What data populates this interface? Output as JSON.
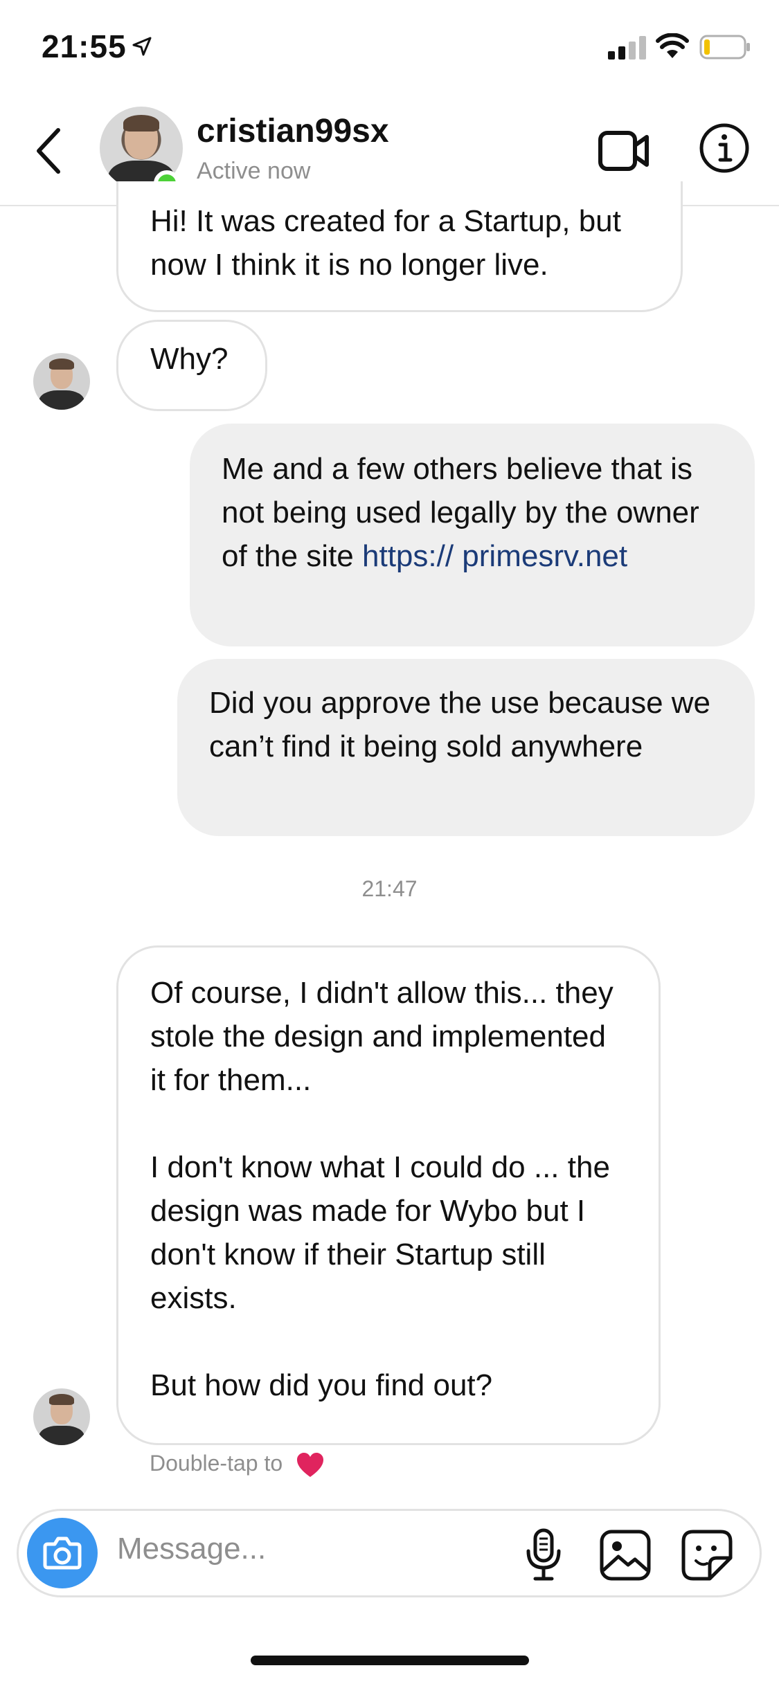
{
  "status_bar": {
    "time": "21:55"
  },
  "header": {
    "username": "cristian99sx",
    "status": "Active now"
  },
  "messages": [
    {
      "sender": "them",
      "text": "Hi! It was created for a Startup, but now I think it is no longer live."
    },
    {
      "sender": "them",
      "text": "Why?"
    },
    {
      "sender": "me",
      "text_before_link": "Me and a few others believe that is not being used legally by the owner of the site ",
      "link": "https:// primesrv.net"
    },
    {
      "sender": "me",
      "text": "Did you approve the use because we can’t find it being sold anywhere"
    },
    {
      "sender": "them",
      "paragraphs": [
        "Of course, I didn't allow this... they stole the design and implemented it for them...",
        "I don't know what I could do ... the design was made for Wybo but I don't know if their Startup still exists.",
        "But how did you find out?"
      ]
    }
  ],
  "timestamp": "21:47",
  "double_tap": "Double-tap to",
  "composer": {
    "placeholder": "Message..."
  },
  "colors": {
    "online": "#4cd137",
    "link": "#1b3b78",
    "camera": "#3b97f0",
    "heart": "#e0245e"
  },
  "icons": [
    "location-arrow-icon",
    "signal-icon",
    "wifi-icon",
    "battery-icon",
    "back-chevron-icon",
    "video-call-icon",
    "info-icon",
    "heart-icon",
    "camera-icon",
    "microphone-icon",
    "gallery-icon",
    "sticker-icon"
  ]
}
